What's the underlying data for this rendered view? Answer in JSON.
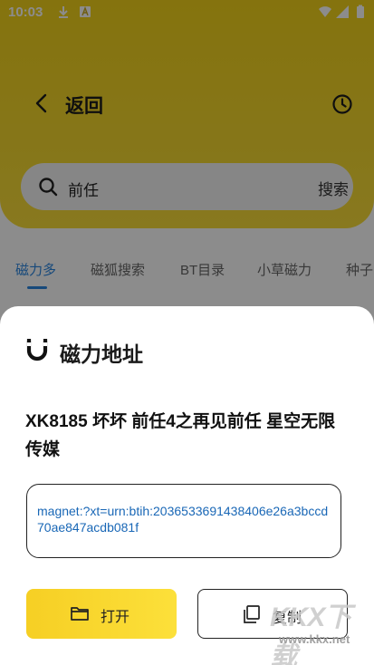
{
  "status_bar": {
    "time": "10:03"
  },
  "header": {
    "back_label": "返回"
  },
  "search": {
    "value": "前任",
    "button_label": "搜索"
  },
  "tabs": [
    {
      "label": "磁力多",
      "active": true
    },
    {
      "label": "磁狐搜索",
      "active": false
    },
    {
      "label": "BT目录",
      "active": false
    },
    {
      "label": "小草磁力",
      "active": false
    },
    {
      "label": "种子",
      "active": false
    }
  ],
  "sheet": {
    "title": "磁力地址",
    "item_title": "XK8185 坏坏 前任4之再见前任 星空无限传媒",
    "magnet_link": "magnet:?xt=urn:btih:2036533691438406e26a3bccd70ae847acdb081f",
    "open_label": "打开",
    "copy_label": "复制"
  },
  "watermark": {
    "logo": "KKX下载",
    "url": "www.kkx.net"
  },
  "colors": {
    "accent_yellow": "#f6cf24",
    "active_tab": "#2a86e0",
    "link": "#1967b6"
  }
}
